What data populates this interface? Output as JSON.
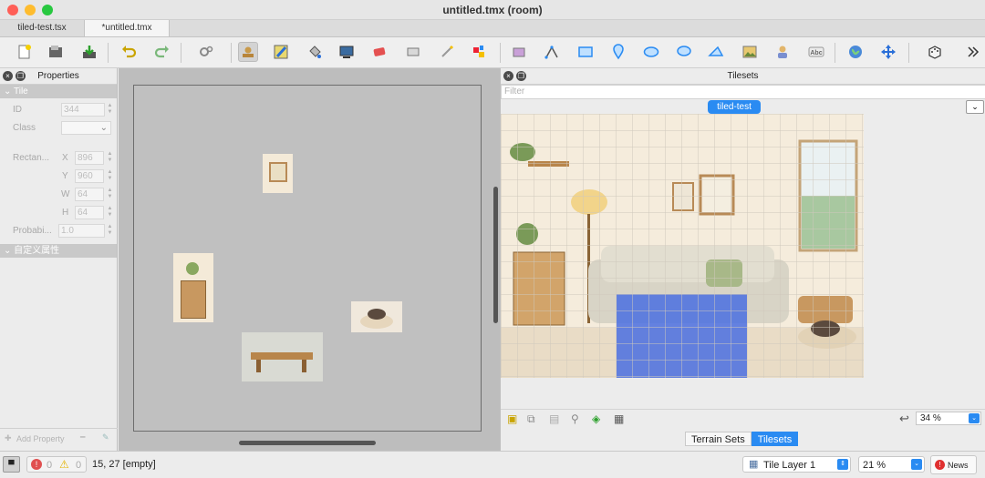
{
  "window": {
    "title": "untitled.tmx (room)"
  },
  "tabs": [
    {
      "label": "tiled-test.tsx"
    },
    {
      "label": "*untitled.tmx"
    }
  ],
  "toolbar": {
    "icons": [
      "new-icon",
      "open-icon",
      "save-icon",
      "undo-icon",
      "redo-icon",
      "command-icon",
      "stamp-icon",
      "terrain-brush-icon",
      "bucket-fill-icon",
      "shape-fill-icon",
      "eraser-icon",
      "rect-select-icon",
      "magic-wand-icon",
      "select-same-icon",
      "insert-tile-icon",
      "edit-polygons-icon",
      "rectangle-icon",
      "point-icon",
      "ellipse-icon",
      "ellipse-alt-icon",
      "polygon-icon",
      "image-object-icon",
      "template-icon",
      "text-icon",
      "world-tool-icon",
      "move-icon",
      "random-mode-icon",
      "more-icon"
    ]
  },
  "properties": {
    "title": "Properties",
    "section_tile": "Tile",
    "id_label": "ID",
    "id_value": "344",
    "class_label": "Class",
    "rect_label": "Rectan...",
    "x_label": "X",
    "x_value": "896",
    "y_label": "Y",
    "y_value": "960",
    "w_label": "W",
    "w_value": "64",
    "h_label": "H",
    "h_value": "64",
    "prob_label": "Probabi...",
    "prob_value": "1.0",
    "section_custom": "自定义属性",
    "add_property": "Add Property"
  },
  "tilesets": {
    "title": "Tilesets",
    "filter_placeholder": "Filter",
    "active_tileset": "tiled-test",
    "zoom": "34 %",
    "tab_terrain": "Terrain Sets",
    "tab_tilesets": "Tilesets"
  },
  "status": {
    "errors": "0",
    "warnings": "0",
    "coords": "15, 27 [empty]",
    "layer": "Tile Layer 1",
    "zoom": "21 %",
    "news": "News"
  }
}
